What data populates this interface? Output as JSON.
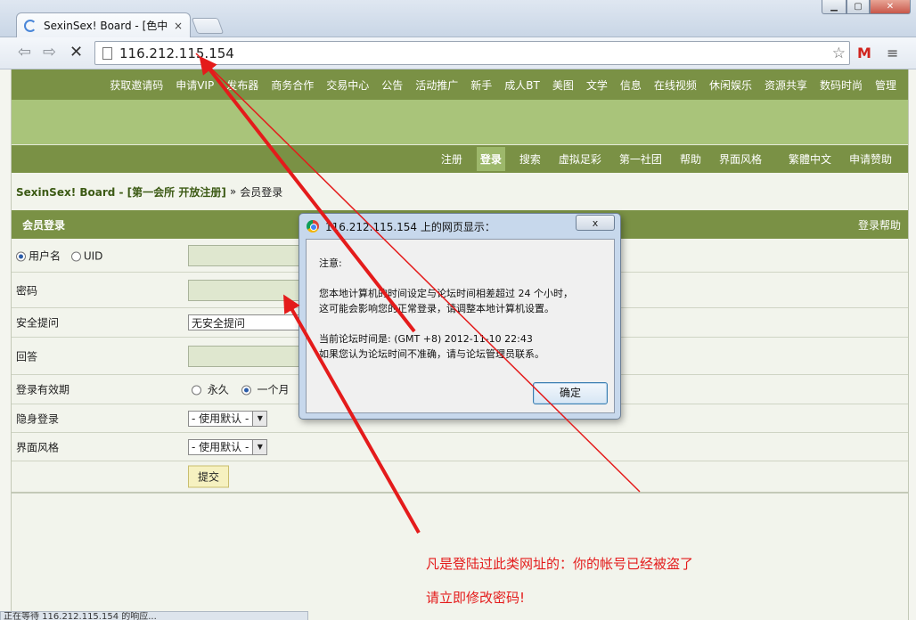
{
  "browser": {
    "tab_title": "SexinSex! Board - [色中",
    "tab_close": "×",
    "url": "116.212.115.154",
    "icons": {
      "back": "back-arrow-icon",
      "forward": "forward-arrow-icon",
      "stop": "stop-icon",
      "star": "bookmark-star-icon",
      "gmail": "gmail-icon",
      "menu": "wrench-menu-icon"
    },
    "status_text": "正在等待 116.212.115.154 的响应..."
  },
  "topnav": [
    "获取邀请码",
    "申请VIP",
    "发布器",
    "商务合作",
    "交易中心",
    "公告",
    "活动推广",
    "新手",
    "成人BT",
    "美图",
    "文学",
    "信息",
    "在线视频",
    "休闲娱乐",
    "资源共享",
    "数码时尚",
    "管理"
  ],
  "subnav": {
    "items": [
      "注册",
      "登录",
      "搜索",
      "虚拟足彩",
      "第一社团",
      "帮助",
      "界面风格"
    ],
    "active": "登录",
    "extra": [
      "繁體中文",
      "申请赞助"
    ]
  },
  "breadcrumb": {
    "forum": "SexinSex! Board - [第一会所 开放注册]",
    "sep": "»",
    "current": "会员登录"
  },
  "form": {
    "title": "会员登录",
    "help": "登录帮助",
    "username_label": "用户名",
    "uid_label": "UID",
    "password_label": "密码",
    "question_label": "安全提问",
    "question_value": "无安全提问",
    "answer_label": "回答",
    "validity_label": "登录有效期",
    "validity_forever": "永久",
    "validity_month": "一个月",
    "invisible_label": "隐身登录",
    "invisible_value": "- 使用默认 -",
    "style_label": "界面风格",
    "style_value": "- 使用默认 -",
    "submit_label": "提交"
  },
  "dialog": {
    "title": "116.212.115.154 上的网页显示：",
    "close": "x",
    "notice": "注意:",
    "line1": "您本地计算机的时间设定与论坛时间相差超过 24 个小时，",
    "line2": "这可能会影响您的正常登录，请调整本地计算机设置。",
    "line3": "当前论坛时间是: (GMT +8) 2012-11-10 22:43",
    "line4": "如果您认为论坛时间不准确，请与论坛管理员联系。",
    "ok": "确定"
  },
  "annotation": {
    "line1": "凡是登陆过此类网址的：你的帐号已经被盗了",
    "line2": "请立即修改密码!",
    "color": "#e41b1b"
  }
}
